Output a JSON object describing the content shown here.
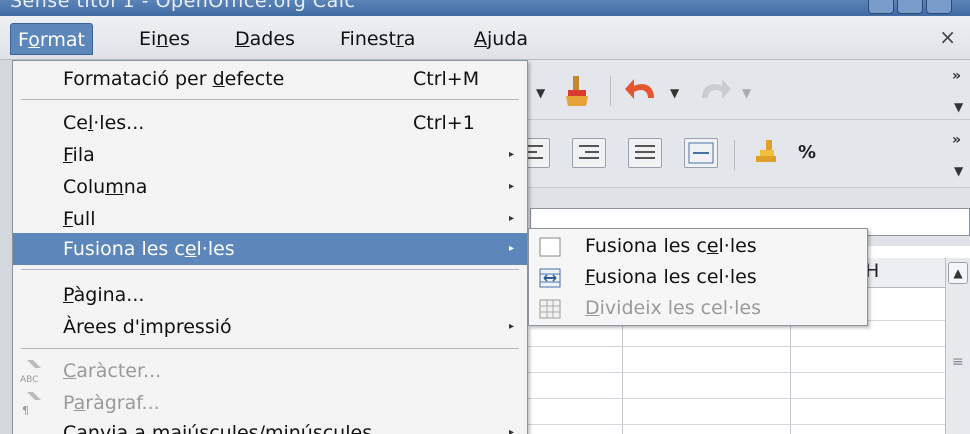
{
  "window": {
    "title": "Sense títol 1 - OpenOffice.org Calc"
  },
  "menubar": {
    "items": [
      {
        "pre": "F",
        "ul": "o",
        "post": "rmat"
      },
      {
        "pre": "Ei",
        "ul": "n",
        "post": "es"
      },
      {
        "pre": "",
        "ul": "D",
        "post": "ades"
      },
      {
        "pre": "Finest",
        "ul": "r",
        "post": "a"
      },
      {
        "pre": "",
        "ul": "A",
        "post": "juda"
      }
    ],
    "close_glyph": "×"
  },
  "format_menu": {
    "items": [
      {
        "pre": "Formatació per ",
        "ul": "d",
        "post": "efecte",
        "shortcut": "Ctrl+M",
        "submenu": false
      },
      {
        "pre": "Ce",
        "ul": "l",
        "post": "·les...",
        "shortcut": "Ctrl+1",
        "submenu": false
      },
      {
        "pre": "",
        "ul": "F",
        "post": "ila",
        "shortcut": "",
        "submenu": true
      },
      {
        "pre": "Colu",
        "ul": "m",
        "post": "na",
        "shortcut": "",
        "submenu": true
      },
      {
        "pre": "",
        "ul": "F",
        "post": "ull",
        "shortcut": "",
        "submenu": true
      },
      {
        "pre": "Fusiona les c",
        "ul": "e",
        "post": "l·les",
        "shortcut": "",
        "submenu": true
      },
      {
        "pre": "",
        "ul": "P",
        "post": "àgina...",
        "shortcut": "",
        "submenu": false
      },
      {
        "pre": "Àrees d'",
        "ul": "i",
        "post": "mpressió",
        "shortcut": "",
        "submenu": true
      },
      {
        "pre": "",
        "ul": "C",
        "post": "aràcter...",
        "shortcut": "",
        "submenu": false
      },
      {
        "pre": "P",
        "ul": "a",
        "post": "ràgraf...",
        "shortcut": "",
        "submenu": false
      },
      {
        "pre": "Canvia a majúscules/minúscules",
        "ul": "",
        "post": "",
        "shortcut": "",
        "submenu": true
      }
    ],
    "submenu_arrow": "▸",
    "icon_labels": {
      "character": "ABC",
      "paragraph": "¶"
    }
  },
  "merge_submenu": {
    "items": [
      {
        "pre": "Fusiona les c",
        "ul": "e",
        "post": "l·les"
      },
      {
        "pre": "",
        "ul": "F",
        "post": "usiona les cel·les"
      },
      {
        "pre": "",
        "ul": "D",
        "post": "ivideix les cel·les"
      }
    ]
  },
  "sheet": {
    "column_header": "H",
    "percent_label": "%",
    "overflow_chevron": "»"
  },
  "colors": {
    "highlight": "#5d86bb",
    "menu_bg": "#f4f4f4",
    "disabled_text": "#9a9a9a"
  }
}
